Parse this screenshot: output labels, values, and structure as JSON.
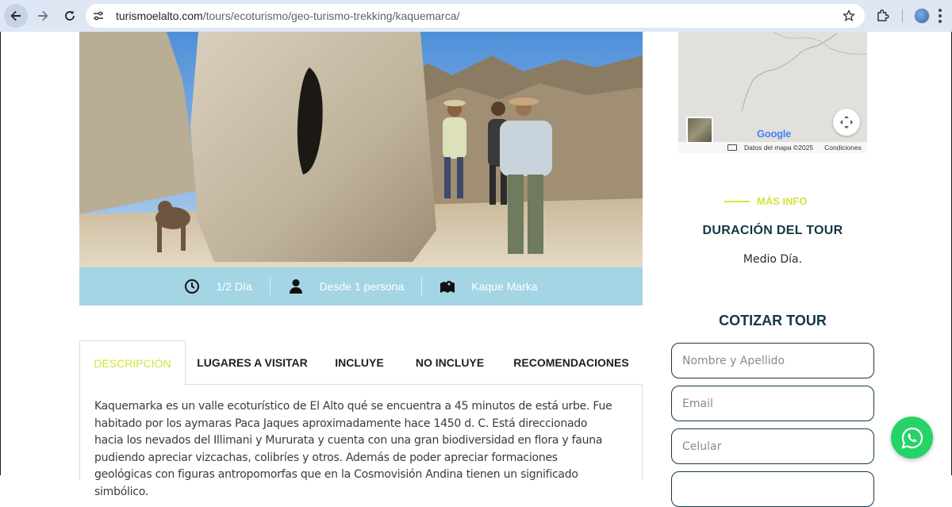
{
  "browser": {
    "url_host": "turismoelalto.com",
    "url_path": "/tours/ecoturismo/geo-turismo-trekking/kaquemarca/",
    "icons": [
      "back-arrow-icon",
      "forward-arrow-icon",
      "reload-icon",
      "site-info-icon",
      "bookmark-star-icon",
      "extensions-icon",
      "profile-avatar",
      "kebab-menu-icon"
    ]
  },
  "tour_info": {
    "duration": "1/2 Día",
    "group": "Desde 1 persona",
    "location": "Kaque Marka",
    "icons": [
      "clock-icon",
      "person-icon",
      "map-marker-icon"
    ]
  },
  "tabs": [
    {
      "label": "DESCRIPCIÓN",
      "active": true
    },
    {
      "label": "LUGARES A VISITAR",
      "active": false
    },
    {
      "label": "INCLUYE",
      "active": false
    },
    {
      "label": "NO INCLUYE",
      "active": false
    },
    {
      "label": "RECOMENDACIONES",
      "active": false
    }
  ],
  "description": "Kaquemarka es un valle ecoturístico de El Alto qué se encuentra a 45 minutos de está urbe. Fue habitado por los aymaras Paca Jaques aproximadamente hace 1450 d. C. Está direccionado hacia los nevados del Illimani y Mururata y cuenta con una gran biodiversidad en flora y fauna pudiendo apreciar vizcachas, colibríes y otros. Además de poder apreciar formaciones geológicas con figuras antropomorfas que en la Cosmovisión Andina tienen un significado simbólico.",
  "map": {
    "brand": "Google",
    "attribution": "Datos del mapa ©2025",
    "terms": "Condiciones"
  },
  "sidebar": {
    "more_info": "MÁS INFO",
    "duration_title": "DURACIÓN DEL TOUR",
    "duration_value": "Medio Día.",
    "quote_title": "COTIZAR TOUR",
    "fields": {
      "name_placeholder": "Nombre y Apellido",
      "email_placeholder": "Email",
      "phone_placeholder": "Celular"
    }
  },
  "colors": {
    "accent": "#d6e33a",
    "heading": "#123845",
    "info_bar": "#a3d5e5",
    "whatsapp": "#25d366"
  }
}
